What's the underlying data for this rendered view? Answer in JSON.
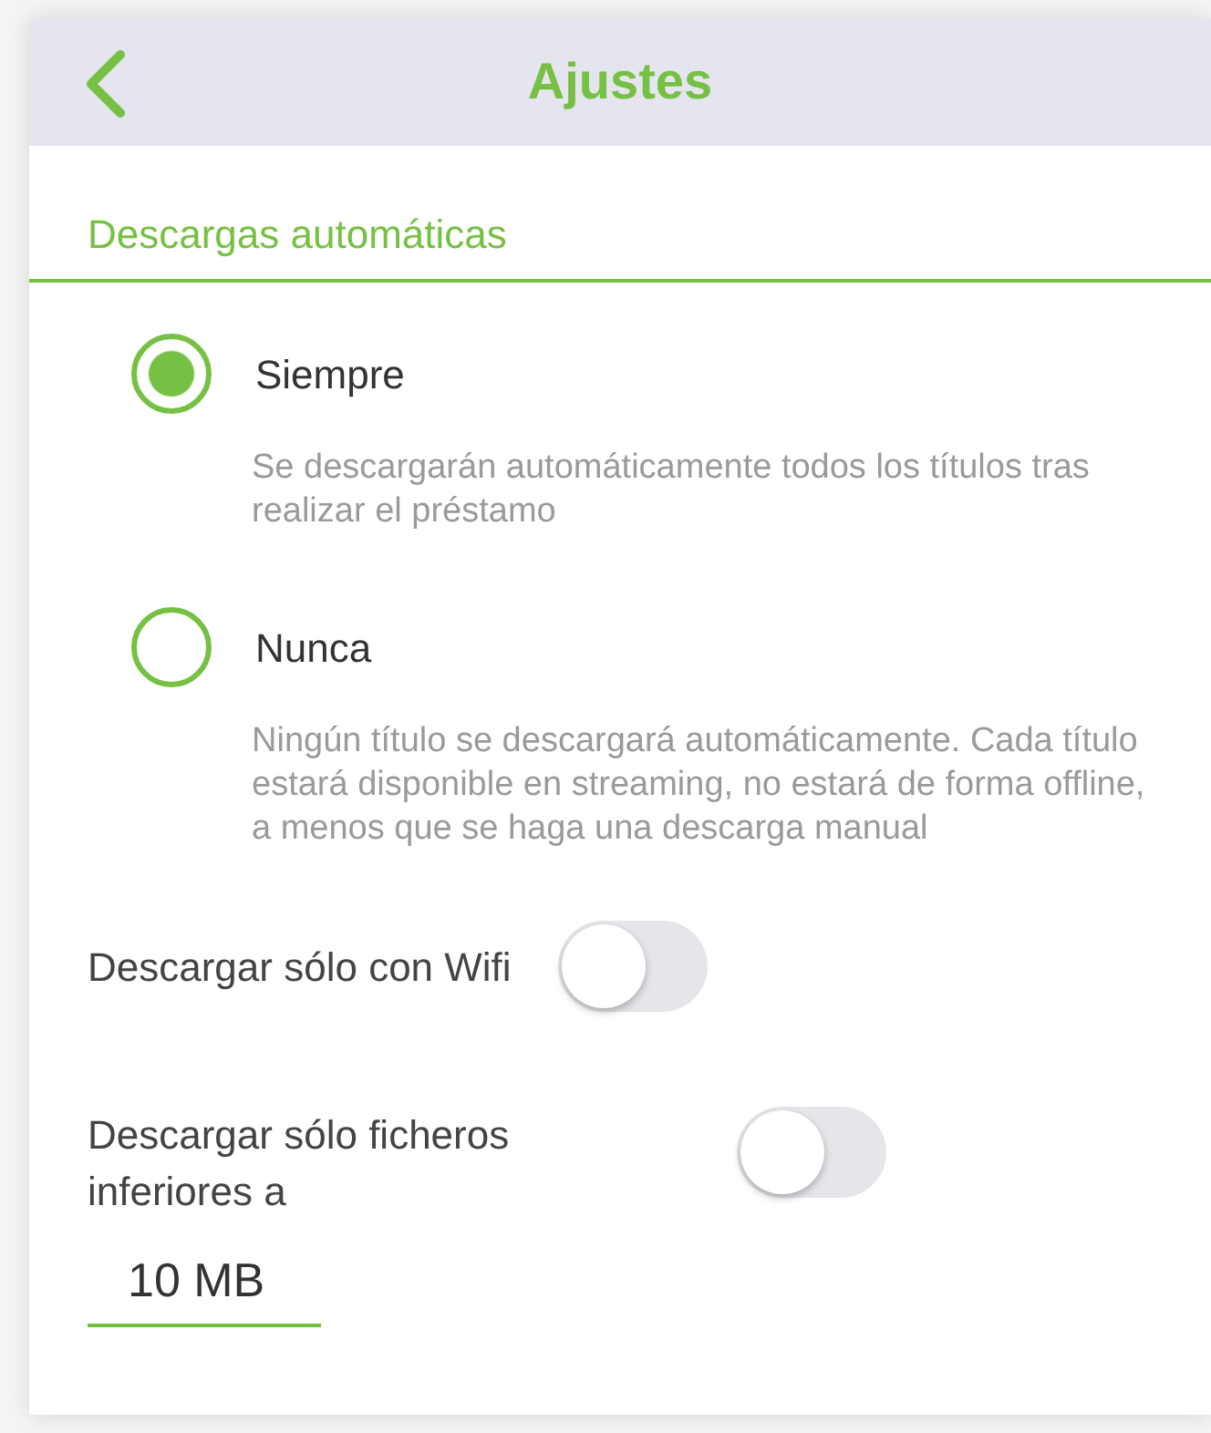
{
  "header": {
    "title": "Ajustes"
  },
  "section": {
    "title": "Descargas automáticas"
  },
  "options": [
    {
      "label": "Siempre",
      "description": "Se descargarán automáticamente todos los títulos tras realizar el préstamo",
      "selected": true
    },
    {
      "label": "Nunca",
      "description": "Ningún título se descargará automáticamente. Cada título estará disponible en streaming, no estará de forma offline, a menos que se haga una descarga manual",
      "selected": false
    }
  ],
  "toggles": [
    {
      "label": "Descargar sólo con Wifi",
      "on": false
    },
    {
      "label": "Descargar sólo ficheros inferiores a",
      "on": false
    }
  ],
  "size_field": {
    "value": "10 MB"
  }
}
